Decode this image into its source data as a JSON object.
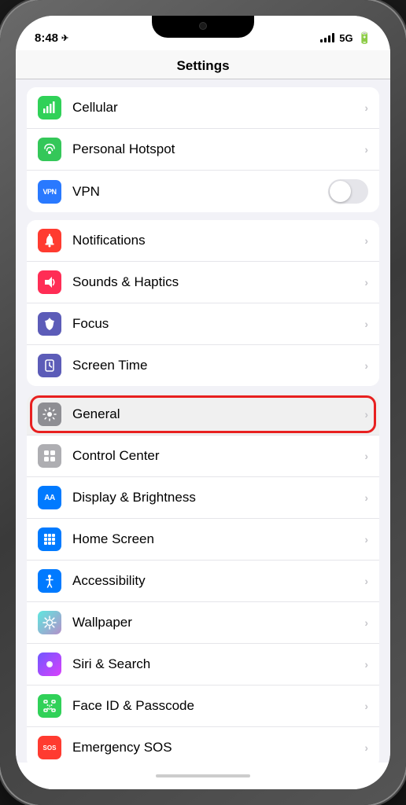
{
  "statusBar": {
    "time": "8:48",
    "locationIcon": "◂",
    "signal5g": "5G",
    "batteryFull": true
  },
  "header": {
    "title": "Settings"
  },
  "groups": [
    {
      "id": "connectivity",
      "items": [
        {
          "id": "cellular",
          "icon": "cellular",
          "iconBg": "icon-cellular-green",
          "iconSymbol": "▲",
          "label": "Cellular",
          "showChevron": true
        },
        {
          "id": "personal-hotspot",
          "icon": "hotspot",
          "iconBg": "icon-green",
          "iconSymbol": "⟳",
          "label": "Personal Hotspot",
          "showChevron": true
        },
        {
          "id": "vpn",
          "icon": "vpn",
          "iconBg": "icon-vpn-blue",
          "iconSymbol": "VPN",
          "label": "VPN",
          "showToggle": true,
          "toggleOn": false,
          "showChevron": false
        }
      ]
    },
    {
      "id": "system",
      "items": [
        {
          "id": "notifications",
          "icon": "bell",
          "iconBg": "icon-red",
          "iconSymbol": "🔔",
          "label": "Notifications",
          "showChevron": true
        },
        {
          "id": "sounds-haptics",
          "icon": "sound",
          "iconBg": "icon-pink",
          "iconSymbol": "🔊",
          "label": "Sounds & Haptics",
          "showChevron": true
        },
        {
          "id": "focus",
          "icon": "moon",
          "iconBg": "icon-indigo",
          "iconSymbol": "🌙",
          "label": "Focus",
          "showChevron": true
        },
        {
          "id": "screen-time",
          "icon": "hourglass",
          "iconBg": "icon-indigo",
          "iconSymbol": "⧗",
          "label": "Screen Time",
          "showChevron": true
        }
      ]
    },
    {
      "id": "display-group",
      "items": [
        {
          "id": "general",
          "icon": "gear",
          "iconBg": "icon-gray",
          "iconSymbol": "⚙",
          "label": "General",
          "showChevron": true,
          "highlighted": true
        },
        {
          "id": "control-center",
          "icon": "sliders",
          "iconBg": "icon-light-gray",
          "iconSymbol": "⊞",
          "label": "Control Center",
          "showChevron": true
        },
        {
          "id": "display-brightness",
          "icon": "aa",
          "iconBg": "icon-aa-blue",
          "iconSymbol": "AA",
          "label": "Display & Brightness",
          "showChevron": true
        },
        {
          "id": "home-screen",
          "icon": "home",
          "iconBg": "icon-keyboard-blue",
          "iconSymbol": "⊞",
          "label": "Home Screen",
          "showChevron": true
        },
        {
          "id": "accessibility",
          "icon": "accessibility",
          "iconBg": "icon-accessibility-blue",
          "iconSymbol": "♿",
          "label": "Accessibility",
          "showChevron": true
        },
        {
          "id": "wallpaper",
          "icon": "flower",
          "iconBg": "icon-wallpaper-teal",
          "iconSymbol": "❋",
          "label": "Wallpaper",
          "showChevron": true
        },
        {
          "id": "siri-search",
          "icon": "siri",
          "iconBg": "icon-siri",
          "iconSymbol": "◉",
          "label": "Siri & Search",
          "showChevron": true
        },
        {
          "id": "face-id",
          "icon": "faceid",
          "iconBg": "icon-faceid-green",
          "iconSymbol": "⊡",
          "label": "Face ID & Passcode",
          "showChevron": true
        },
        {
          "id": "emergency-sos",
          "icon": "sos",
          "iconBg": "icon-sos-red",
          "iconSymbol": "SOS",
          "label": "Emergency SOS",
          "showChevron": true
        }
      ]
    }
  ],
  "labels": {
    "chevron": "›",
    "settings_title": "Settings"
  }
}
